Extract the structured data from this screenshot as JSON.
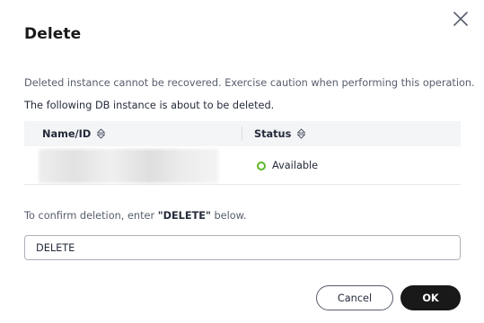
{
  "dialog": {
    "title": "Delete",
    "warning_text": "Deleted instance cannot be recovered. Exercise caution when performing this operation.",
    "sub_text": "The following DB instance is about to be deleted."
  },
  "table": {
    "columns": [
      {
        "label": "Name/ID",
        "sortable": true
      },
      {
        "label": "Status",
        "sortable": true
      }
    ],
    "rows": [
      {
        "name_id": "",
        "status": "Available"
      }
    ]
  },
  "confirm": {
    "prefix": "To confirm deletion, enter ",
    "keyword": "\"DELETE\"",
    "suffix": " below."
  },
  "input": {
    "value": "DELETE"
  },
  "buttons": {
    "cancel": "Cancel",
    "ok": "OK"
  },
  "colors": {
    "available": "#5eb829",
    "primary_button": "#191919",
    "header_bg": "#f3f5f7"
  },
  "icons": {
    "close": "close-icon",
    "sort": "sort-icon",
    "status": "status-available-icon"
  }
}
